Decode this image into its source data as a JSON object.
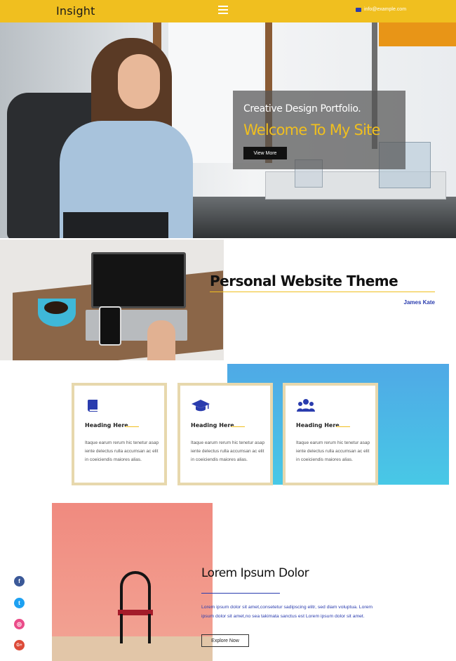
{
  "header": {
    "logo": "Insight",
    "email": "info@example.com",
    "accent": "#f0bf1f"
  },
  "hero": {
    "subtitle": "Creative Design Portfolio.",
    "title": "Welcome To My Site",
    "button": "View More"
  },
  "about": {
    "title": "Personal Website Theme",
    "author": "James Kate"
  },
  "services": [
    {
      "icon": "book-icon",
      "heading": "Heading Here",
      "text": "Itaque earum rerum hic tenetur asap iente delectus rulla accumsan ac elit in coeiciendis maiores alias."
    },
    {
      "icon": "graduation-cap-icon",
      "heading": "Heading Here",
      "text": "Itaque earum rerum hic tenetur asap iente delectus rulla accumsan ac elit in coeiciendis maiores alias."
    },
    {
      "icon": "users-icon",
      "heading": "Heading Here",
      "text": "Itaque earum rerum hic tenetur asap iente delectus rulla accumsan ac elit in coeiciendis maiores alias."
    }
  ],
  "feature": {
    "title": "Lorem Ipsum Dolor",
    "text": "Lorem ipsum dolor sit amet,consetetur sadipscing elitr, sed diam voluptua. Lorem ipsum dolor sit amet,no sea takimata sanctus est Lorem ipsum dolor sit amet.",
    "button": "Explore Now"
  },
  "social": [
    {
      "name": "facebook-icon",
      "glyph": "f",
      "color": "#3b5998"
    },
    {
      "name": "twitter-icon",
      "glyph": "t",
      "color": "#1da1f2"
    },
    {
      "name": "dribbble-icon",
      "glyph": "◎",
      "color": "#ea4c89"
    },
    {
      "name": "google-plus-icon",
      "glyph": "G+",
      "color": "#dd4b39"
    }
  ],
  "colors": {
    "brand_blue": "#2a3cae",
    "card_border": "#e7d8ad"
  }
}
